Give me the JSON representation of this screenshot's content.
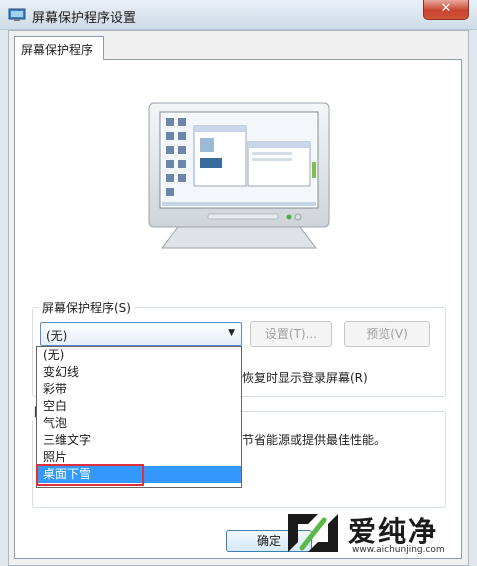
{
  "window": {
    "title": "屏幕保护程序设置",
    "close_label": "✕"
  },
  "tab": {
    "label": "屏幕保护程序"
  },
  "screensaver_group": {
    "label": "屏幕保护程序(S)",
    "selected_value": "(无)",
    "settings_button": "设置(T)...",
    "preview_button": "预览(V)",
    "resume_checkbox_partial": "恢复时显示登录屏幕(R)"
  },
  "dropdown": {
    "options": [
      "(无)",
      "变幻线",
      "彩带",
      "空白",
      "气泡",
      "三维文字",
      "照片",
      "桌面下雪"
    ],
    "selected_index": 7
  },
  "power_group": {
    "label_partial": "目",
    "text_partial": "节省能源或提供最佳性能。"
  },
  "buttons": {
    "ok": "确定"
  },
  "watermark": {
    "brand": "爱纯净",
    "url": "www.aichunjing.com"
  },
  "colors": {
    "selection": "#3399ff",
    "highlight_border": "#e0303b",
    "close_button": "#c8452f"
  }
}
